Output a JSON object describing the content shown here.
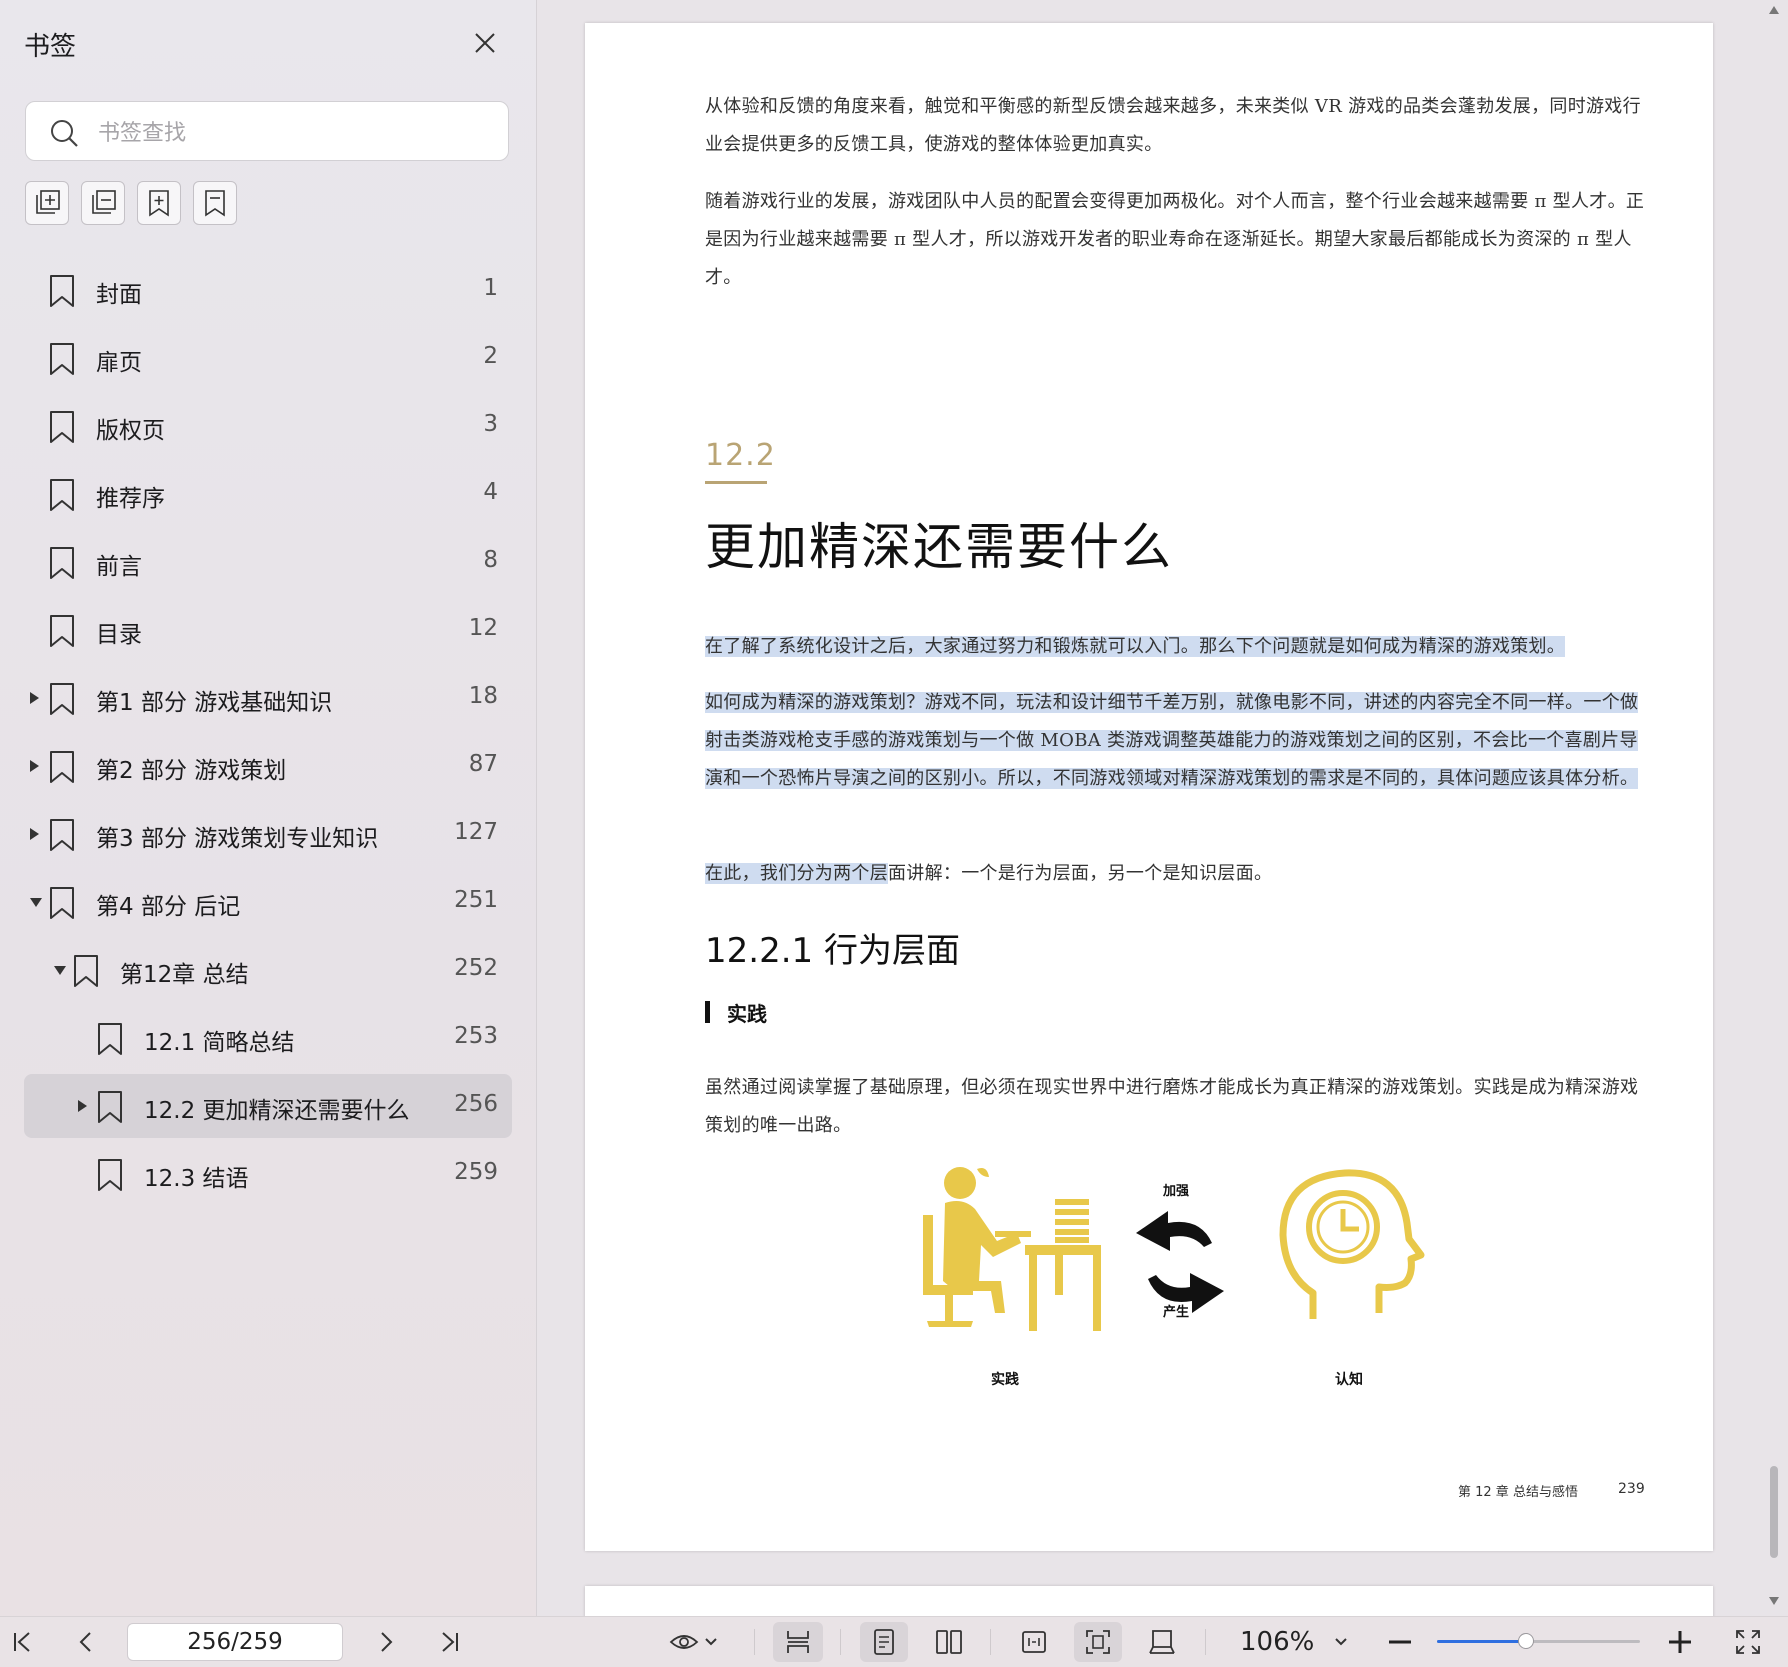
{
  "sidebar": {
    "title": "书签",
    "search_placeholder": "书签查找",
    "tools": [
      {
        "icon": "expand-all-icon"
      },
      {
        "icon": "collapse-all-icon"
      },
      {
        "icon": "add-bookmark-icon"
      },
      {
        "icon": "bookmark-outline-icon"
      }
    ],
    "bookmarks": [
      {
        "label": "封面",
        "page": "1",
        "level": 0,
        "toggle": "none"
      },
      {
        "label": "扉页",
        "page": "2",
        "level": 0,
        "toggle": "none"
      },
      {
        "label": "版权页",
        "page": "3",
        "level": 0,
        "toggle": "none"
      },
      {
        "label": "推荐序",
        "page": "4",
        "level": 0,
        "toggle": "none"
      },
      {
        "label": "前言",
        "page": "8",
        "level": 0,
        "toggle": "none"
      },
      {
        "label": "目录",
        "page": "12",
        "level": 0,
        "toggle": "none"
      },
      {
        "label": "第1 部分  游戏基础知识",
        "page": "18",
        "level": 0,
        "toggle": "collapsed"
      },
      {
        "label": "第2 部分  游戏策划",
        "page": "87",
        "level": 0,
        "toggle": "collapsed"
      },
      {
        "label": "第3 部分  游戏策划专业知识",
        "page": "127",
        "level": 0,
        "toggle": "collapsed"
      },
      {
        "label": "第4 部分  后记",
        "page": "251",
        "level": 0,
        "toggle": "expanded"
      },
      {
        "label": "第12章  总结",
        "page": "252",
        "level": 1,
        "toggle": "expanded"
      },
      {
        "label": "12.1 简略总结",
        "page": "253",
        "level": 2,
        "toggle": "none"
      },
      {
        "label": "12.2 更加精深还需要什么",
        "page": "256",
        "level": 2,
        "toggle": "collapsed",
        "selected": true
      },
      {
        "label": "12.3 结语",
        "page": "259",
        "level": 2,
        "toggle": "none"
      }
    ]
  },
  "document": {
    "para1": "从体验和反馈的角度来看，触觉和平衡感的新型反馈会越来越多，未来类似 VR 游戏的品类会蓬勃发展，同时游戏行业会提供更多的反馈工具，使游戏的整体体验更加真实。",
    "para2": "随着游戏行业的发展，游戏团队中人员的配置会变得更加两极化。对个人而言，整个行业会越来越需要 π 型人才。正是因为行业越来越需要 π 型人才，所以游戏开发者的职业寿命在逐渐延长。期望大家最后都能成长为资深的 π 型人才。",
    "section_number": "12.2",
    "section_title": "更加精深还需要什么",
    "para3": "在了解了系统化设计之后，大家通过努力和锻炼就可以入门。那么下个问题就是如何成为精深的游戏策划。",
    "para4": "如何成为精深的游戏策划？游戏不同，玩法和设计细节千差万别，就像电影不同，讲述的内容完全不同一样。一个做射击类游戏枪支手感的游戏策划与一个做 MOBA 类游戏调整英雄能力的游戏策划之间的区别，不会比一个喜剧片导演和一个恐怖片导演之间的区别小。所以，不同游戏领域对精深游戏策划的需求是不同的，具体问题应该具体分析。",
    "para5_highlighted": "在此，我们分为两个层",
    "para5_rest": "面讲解：一个是行为层面，另一个是知识层面。",
    "subsection_title": "12.2.1  行为层面",
    "subsubsection_title": "实践",
    "para6": "虽然通过阅读掌握了基础原理，但必须在现实世界中进行磨炼才能成长为真正精深的游戏策划。实践是成为精深游戏策划的唯一出路。",
    "figure": {
      "label_practice": "实践",
      "label_cognition": "认知",
      "label_strengthen": "加强",
      "label_produce": "产生",
      "accent_color": "#e8c84a"
    },
    "footer_chapter": "第 12 章    总结与感悟",
    "footer_page": "239"
  },
  "toolbar": {
    "page_indicator": "256/259",
    "zoom": "106%",
    "zoom_slider_fraction": 0.44,
    "accent": "#2f6fe0"
  }
}
